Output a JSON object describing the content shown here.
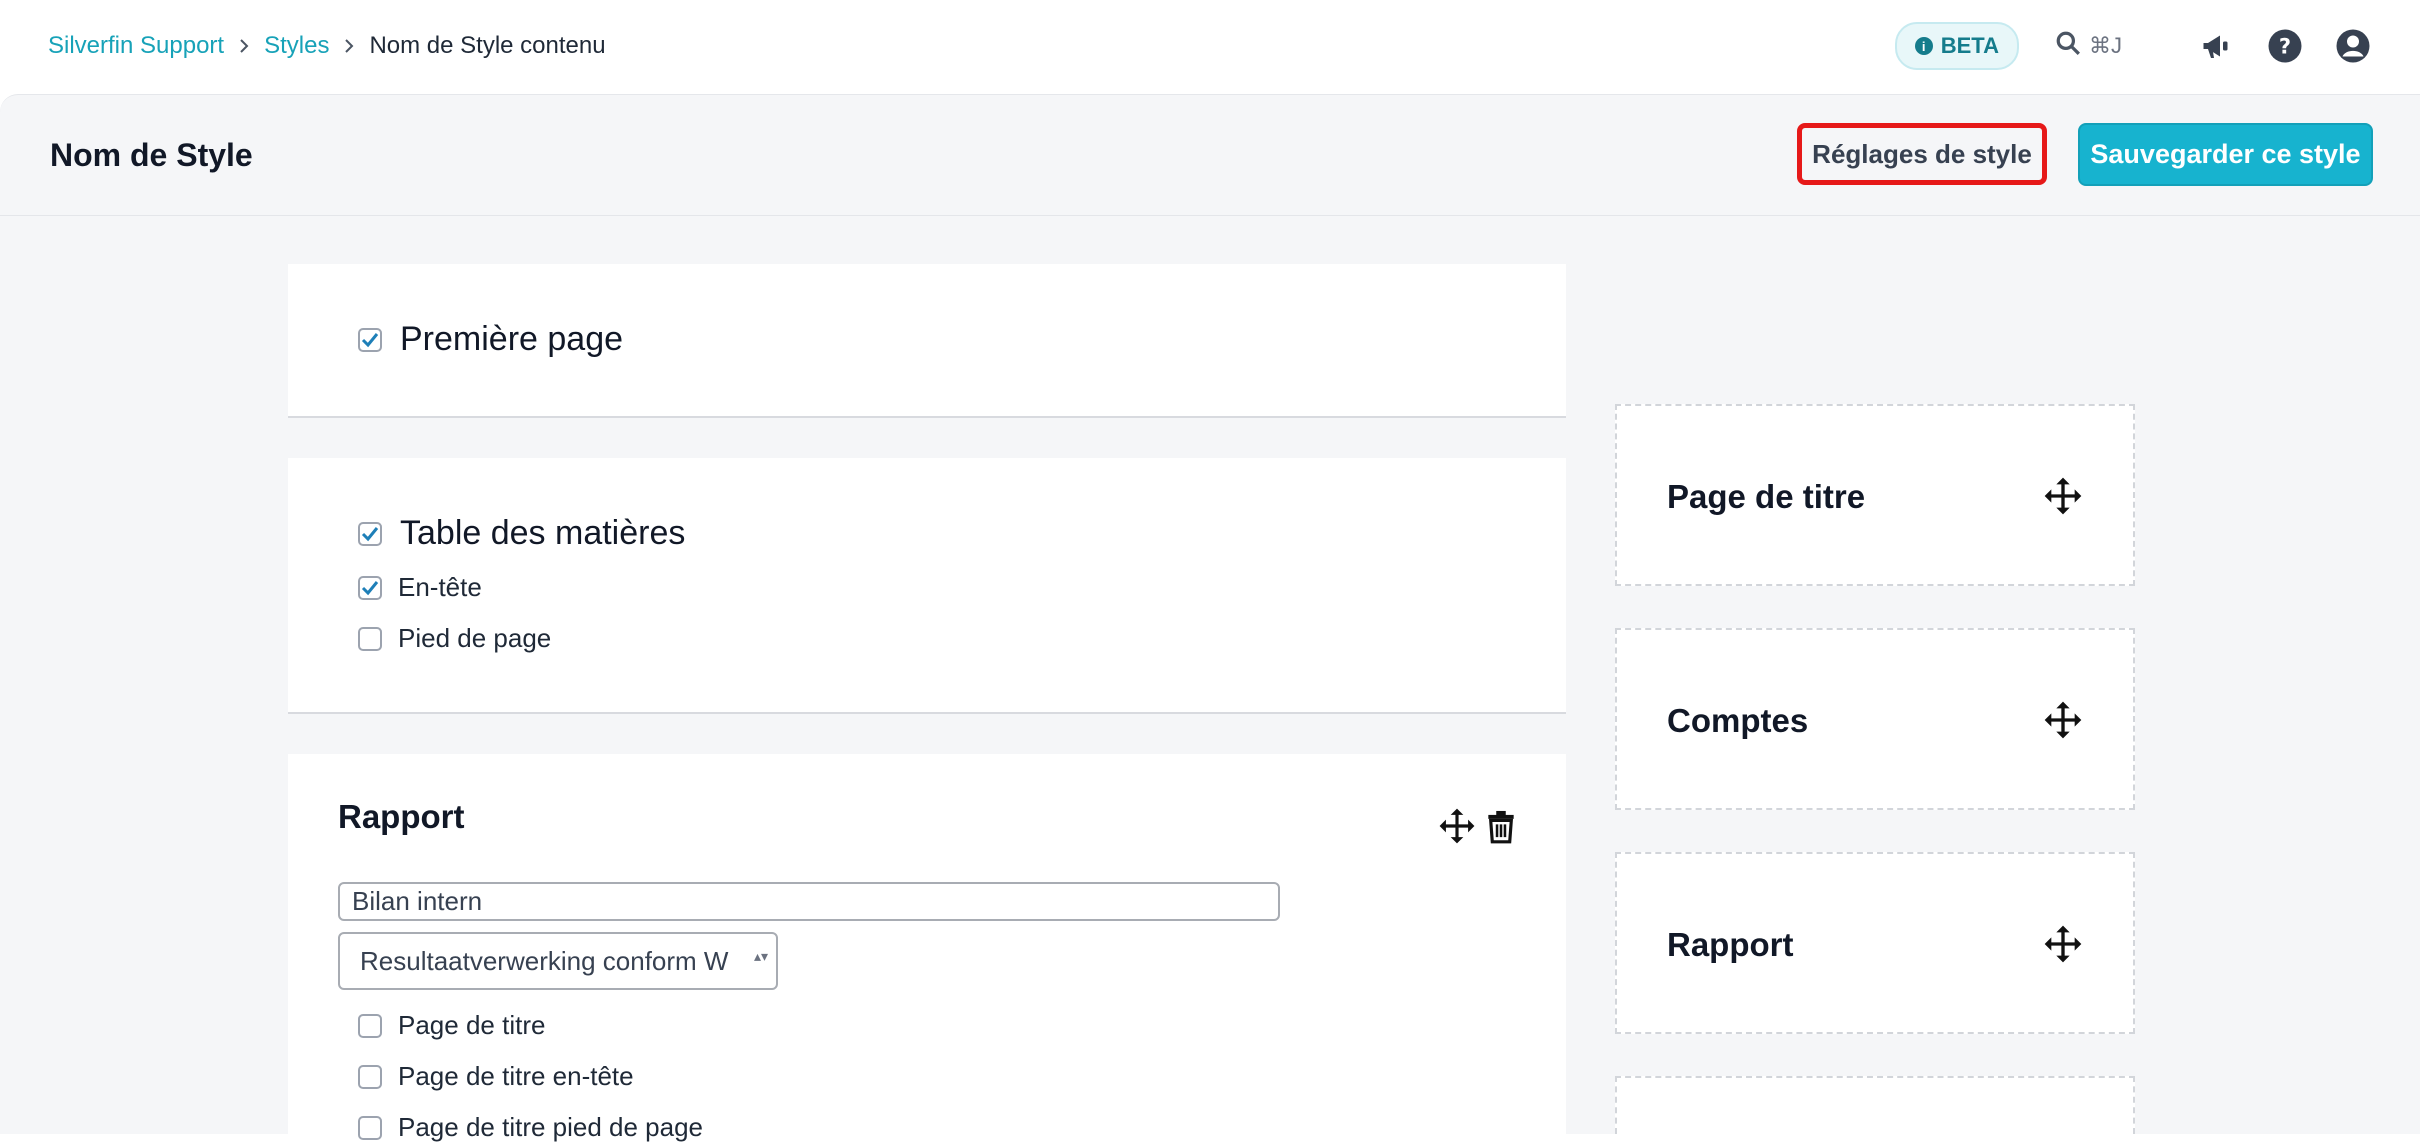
{
  "breadcrumb": {
    "items": [
      "Silverfin Support",
      "Styles"
    ],
    "current": "Nom de Style contenu"
  },
  "topbar": {
    "beta_label": "BETA",
    "search_shortcut": "⌘J",
    "icons": [
      "search-icon",
      "megaphone-icon",
      "help-icon",
      "user-icon"
    ]
  },
  "header": {
    "title": "Nom de Style",
    "settings_button": "Réglages de style",
    "save_button": "Sauvegarder ce style"
  },
  "sections": {
    "first_page": {
      "label": "Première page",
      "checked": true
    },
    "toc": {
      "label": "Table des matières",
      "checked": true,
      "options": [
        {
          "label": "En-tête",
          "checked": true
        },
        {
          "label": "Pied de page",
          "checked": false
        }
      ]
    },
    "report": {
      "title": "Rapport",
      "name_value": "Bilan intern",
      "select_value": "Resultaatverwerking conform W",
      "options": [
        {
          "label": "Page de titre",
          "checked": false
        },
        {
          "label": "Page de titre en-tête",
          "checked": false
        },
        {
          "label": "Page de titre pied de page",
          "checked": false
        }
      ]
    }
  },
  "sidebar": {
    "items": [
      "Page de titre",
      "Comptes",
      "Rapport"
    ]
  },
  "colors": {
    "accent": "#17b3cf",
    "link": "#17a2b8",
    "highlight": "#e61919",
    "check": "#1e7fb8"
  }
}
